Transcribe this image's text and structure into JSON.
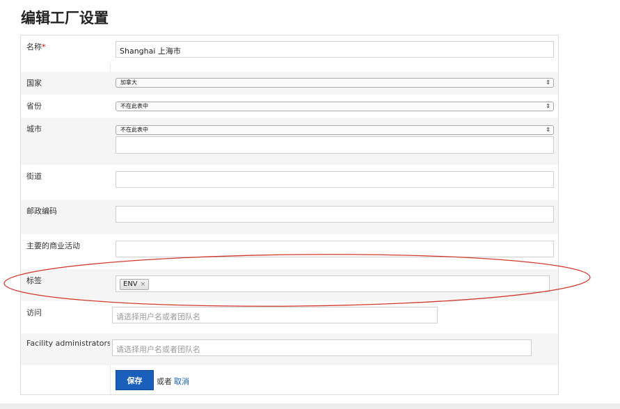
{
  "page": {
    "title": "编辑工厂设置"
  },
  "form": {
    "name": {
      "label": "名称",
      "required_mark": "*",
      "value": "Shanghai 上海市"
    },
    "country": {
      "label": "国家",
      "selected": "加拿大"
    },
    "province": {
      "label": "省份",
      "selected": "不在此表中"
    },
    "city": {
      "label": "城市",
      "selected": "不在此表中",
      "extra_value": ""
    },
    "street": {
      "label": "街道",
      "value": ""
    },
    "postal": {
      "label": "邮政编码",
      "value": ""
    },
    "business": {
      "label": "主要的商业活动",
      "value": ""
    },
    "tags": {
      "label": "标签",
      "items": [
        "ENV"
      ],
      "remove_glyph": "×"
    },
    "access": {
      "label": "访问",
      "placeholder": "请选择用户名或者团队名"
    },
    "admins": {
      "label": "Facility administrators",
      "placeholder": "请选择用户名或者团队名"
    }
  },
  "actions": {
    "save_label": "保存",
    "or_text": "或者",
    "cancel_label": "取消"
  },
  "annotation": {
    "color": "#d0392b"
  },
  "icons": {
    "select_arrows": "⇕"
  }
}
